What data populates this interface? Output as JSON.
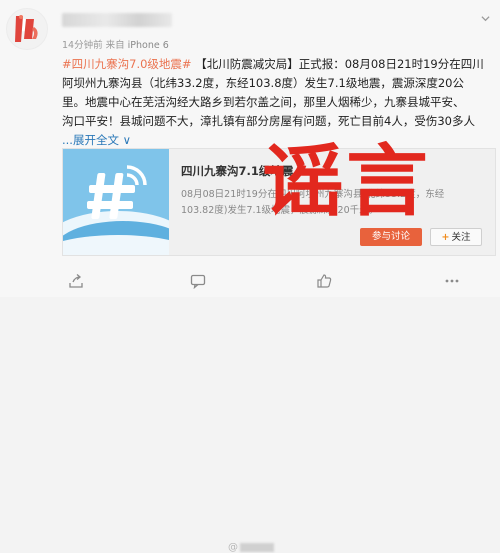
{
  "post": {
    "time": "14分钟前",
    "source_prefix": "来自",
    "source": "iPhone 6",
    "lines": {
      "l1_hashtag": "#四川九寨沟7.0级地震#",
      "l1_tag": "【北川防震减灾局】",
      "l1_text": "正式报：08月08日21时19分在四川",
      "l2": "阿坝州九寨沟县（北纬33.2度，东经103.8度）发生7.1级地震，震源深度20公",
      "l3": "里。地震中心在芜活沟经大路乡到若尔盖之间，那里人烟稀少，九寨县城平安、",
      "l4": "沟口平安！县城问题不大，漳扎镇有部分房屋有问题，死亡目前4人，受伤30多人",
      "expand": "...展开全文 ∨"
    }
  },
  "share_card": {
    "title": "四川九寨沟7.1级地震",
    "desc_line1": "08月08日21时19分在四川阿坝州九寨沟县(北纬33.2度，东经",
    "desc_line2": "103.82度)发生7.1级地震，震源深度20千米。",
    "join_button": "参与讨论",
    "follow_button": "关注",
    "follow_plus": "+"
  },
  "stamp": {
    "text": "谣言",
    "color": "#e2281e"
  },
  "watermark": {
    "text": "@"
  },
  "icons": {
    "avatar": "avatar-logo",
    "menu": "chevron-down-icon",
    "thumbnail": "wifi-hash-icon",
    "share": "share-icon",
    "comment": "comment-icon",
    "like": "like-icon",
    "more": "more-icon"
  },
  "colors": {
    "link_orange": "#eb7350",
    "blue_text": "#2a78b8",
    "thumb_blue": "#7fc4ea",
    "join_orange": "#e8623c"
  }
}
